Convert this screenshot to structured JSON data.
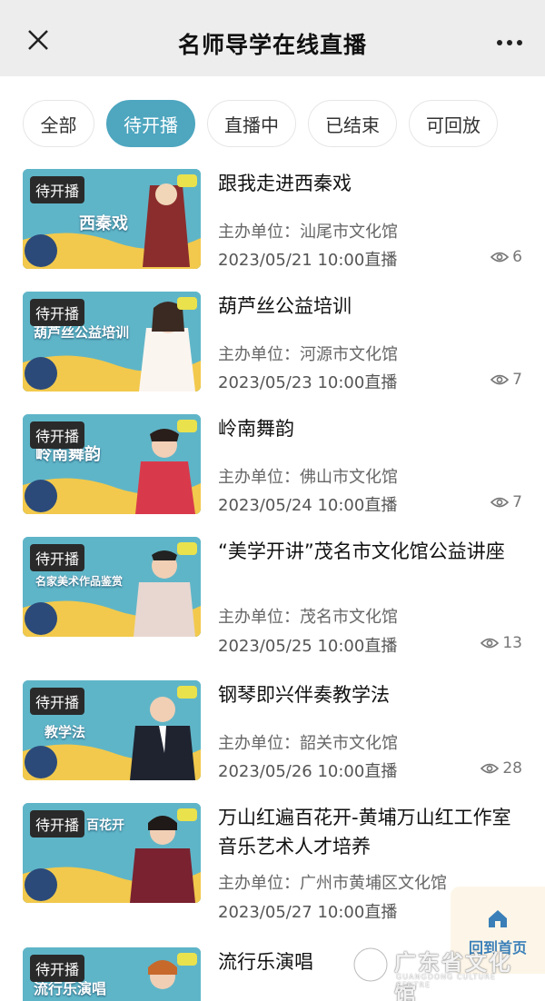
{
  "header": {
    "title": "名师导学在线直播",
    "close_icon": "close-icon",
    "more_icon": "more-icon"
  },
  "tabs": [
    {
      "label": "全部",
      "active": false
    },
    {
      "label": "待开播",
      "active": true
    },
    {
      "label": "直播中",
      "active": false
    },
    {
      "label": "已结束",
      "active": false
    },
    {
      "label": "可回放",
      "active": false
    }
  ],
  "colors": {
    "accent": "#4ea6bf",
    "badge_bg": "#2a2a2a",
    "home_text": "#3a7fb8"
  },
  "items": [
    {
      "badge": "待开播",
      "title": "跟我走进西秦戏",
      "org": "主办单位：汕尾市文化馆",
      "time": "2023/05/21 10:00直播",
      "views": "6",
      "thumb_text": "西秦戏"
    },
    {
      "badge": "待开播",
      "title": "葫芦丝公益培训",
      "org": "主办单位：河源市文化馆",
      "time": "2023/05/23 10:00直播",
      "views": "7",
      "thumb_text": "葫芦丝公益培训"
    },
    {
      "badge": "待开播",
      "title": "岭南舞韵",
      "org": "主办单位：佛山市文化馆",
      "time": "2023/05/24 10:00直播",
      "views": "7",
      "thumb_text": "岭南舞韵"
    },
    {
      "badge": "待开播",
      "title": "“美学开讲”茂名市文化馆公益讲座",
      "org": "主办单位：茂名市文化馆",
      "time": "2023/05/25 10:00直播",
      "views": "13",
      "thumb_text": "名家美术作品鉴赏"
    },
    {
      "badge": "待开播",
      "title": "钢琴即兴伴奏教学法",
      "org": "主办单位：韶关市文化馆",
      "time": "2023/05/26 10:00直播",
      "views": "28",
      "thumb_text": "教学法"
    },
    {
      "badge": "待开播",
      "title": "万山红遍百花开-黄埔万山红工作室音乐艺术人才培养",
      "org": "主办单位：广州市黄埔区文化馆",
      "time": "2023/05/27 10:00直播",
      "views": "",
      "thumb_text": "百花开"
    },
    {
      "badge": "待开播",
      "title": "流行乐演唱",
      "org": "",
      "time": "",
      "views": "",
      "thumb_text": "流行乐演唱"
    }
  ],
  "home_button": {
    "label": "回到首页",
    "icon": "home-icon"
  },
  "watermark": {
    "cn": "广东省文化馆",
    "en": "GUANGDONG CULTURE CENTRE"
  }
}
